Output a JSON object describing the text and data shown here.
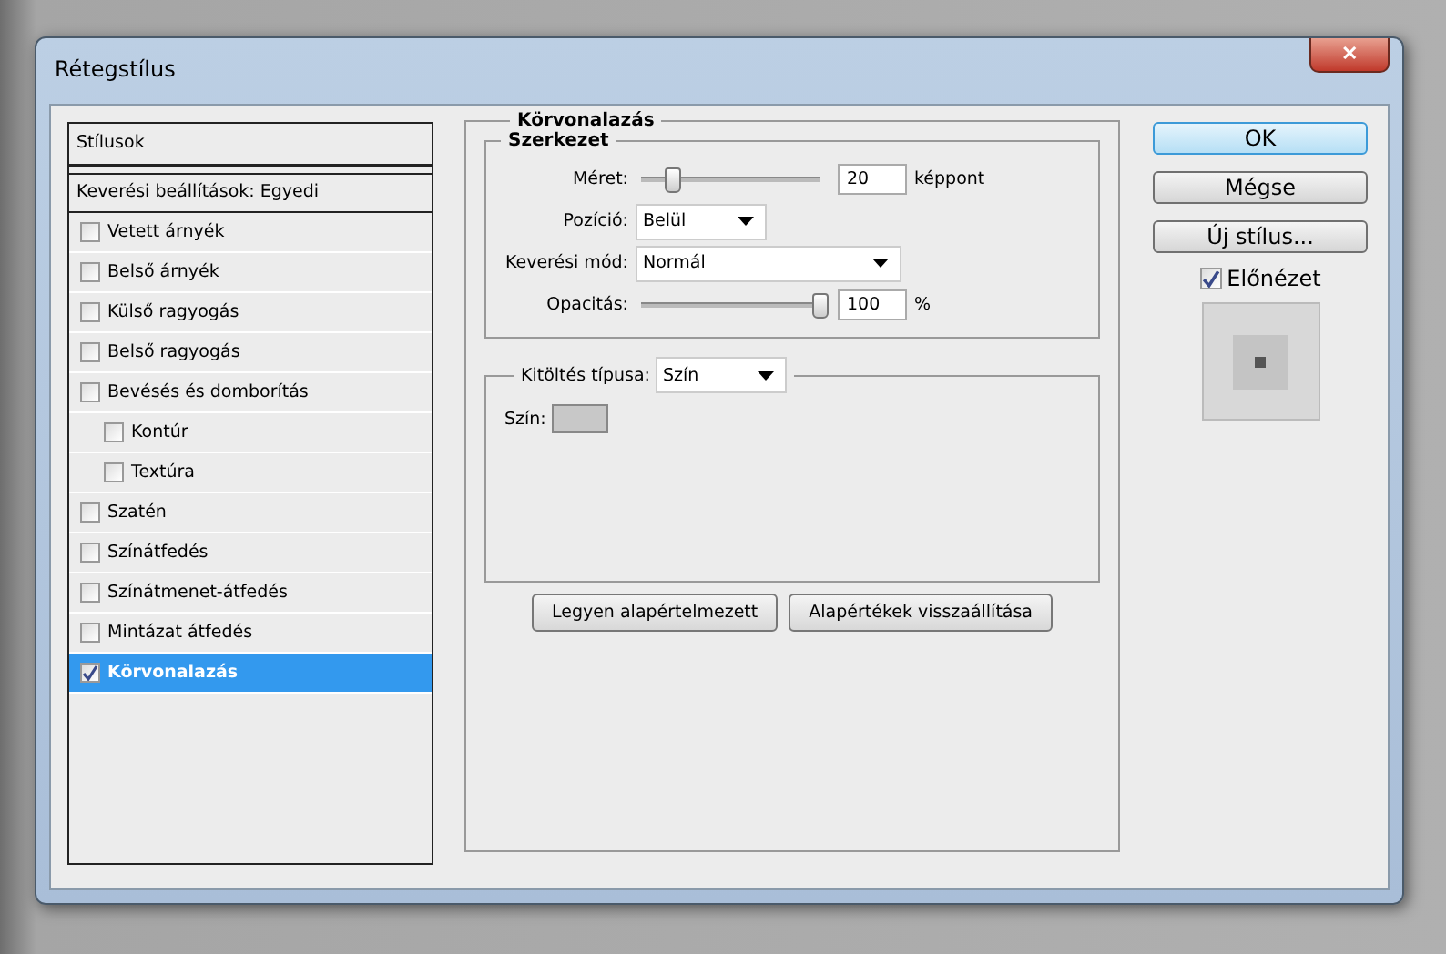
{
  "window": {
    "title": "Rétegstílus",
    "close": "✕"
  },
  "sidebar": {
    "header": "Stílusok",
    "blend": "Keverési beállítások: Egyedi",
    "items": [
      {
        "label": "Vetett árnyék",
        "checked": false,
        "selected": false
      },
      {
        "label": "Belső árnyék",
        "checked": false,
        "selected": false
      },
      {
        "label": "Külső ragyogás",
        "checked": false,
        "selected": false
      },
      {
        "label": "Belső ragyogás",
        "checked": false,
        "selected": false
      },
      {
        "label": "Bevésés és domborítás",
        "checked": false,
        "selected": false,
        "children": [
          {
            "label": "Kontúr",
            "checked": false,
            "selected": false
          },
          {
            "label": "Textúra",
            "checked": false,
            "selected": false
          }
        ]
      },
      {
        "label": "Szatén",
        "checked": false,
        "selected": false
      },
      {
        "label": "Színátfedés",
        "checked": false,
        "selected": false
      },
      {
        "label": "Színátmenet-átfedés",
        "checked": false,
        "selected": false
      },
      {
        "label": "Mintázat átfedés",
        "checked": false,
        "selected": false
      },
      {
        "label": "Körvonalazás",
        "checked": true,
        "selected": true
      }
    ]
  },
  "panel": {
    "title": "Körvonalazás",
    "structure": {
      "title": "Szerkezet",
      "size": {
        "label": "Méret:",
        "level": 0.17,
        "value": "20",
        "unit": "képpont"
      },
      "position": {
        "label": "Pozíció:",
        "value": "Belül"
      },
      "blend_mode": {
        "label": "Keverési mód:",
        "value": "Normál"
      },
      "opacity": {
        "label": "Opacitás:",
        "level": 1,
        "value": "100",
        "unit": "%"
      }
    },
    "fill": {
      "label": "Kitöltés típusa:",
      "value": "Szín",
      "color_label": "Szín:"
    },
    "buttons": [
      "Legyen alapértelmezett",
      "Alapértékek visszaállítása"
    ]
  },
  "actions": [
    {
      "label": "OK",
      "default": true
    },
    {
      "label": "Mégse",
      "default": false
    },
    {
      "label": "Új stílus...",
      "default": false
    }
  ],
  "preview": {
    "label": "Előnézet",
    "checked": true
  }
}
